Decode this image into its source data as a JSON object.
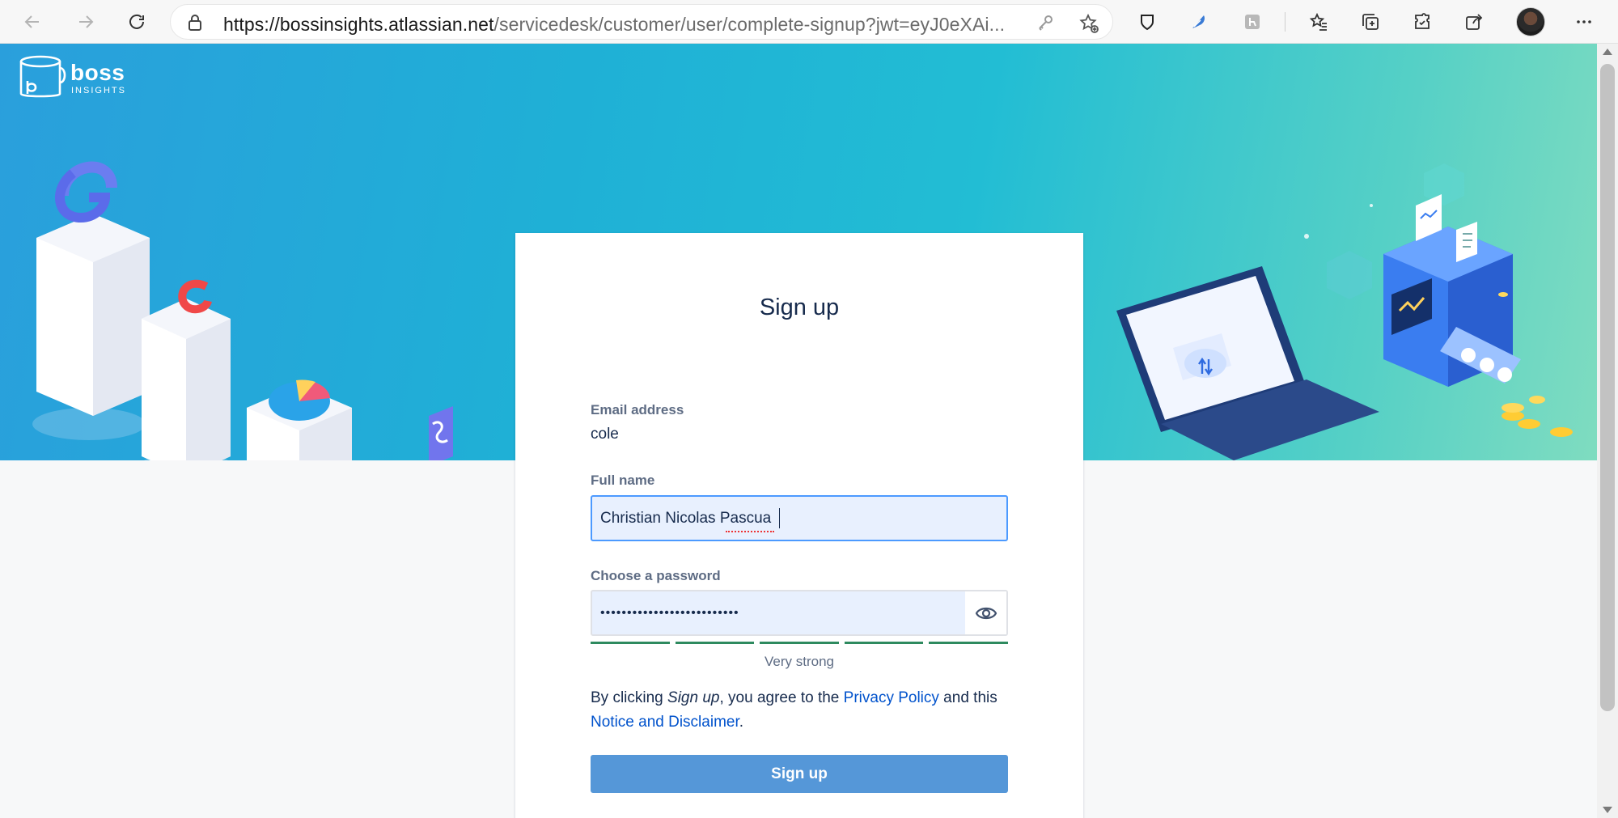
{
  "browser": {
    "url_host": "https://bossinsights.atlassian.net",
    "url_path": "/servicedesk/customer/user/complete-signup?jwt=eyJ0eXAi..."
  },
  "logo": {
    "word": "boss",
    "sub": "INSIGHTS"
  },
  "form": {
    "title": "Sign up",
    "email_label": "Email address",
    "email_value": "cole",
    "fullname_label": "Full name",
    "fullname_value": "Christian Nicolas Pascua",
    "password_label": "Choose a password",
    "password_masked": "••••••••••••••••••••••••••",
    "strength_text": "Very strong",
    "strength_level": 5,
    "terms_prefix": "By clicking ",
    "terms_em": "Sign up",
    "terms_mid": ", you agree to the ",
    "privacy_link": "Privacy Policy",
    "terms_and": " and this ",
    "notice_link": "Notice and Disclaimer",
    "terms_end": ".",
    "signup_button": "Sign up"
  },
  "colors": {
    "accent": "#0052cc",
    "button": "#5597d8",
    "strength_bar": "#2e8a5f",
    "focus_ring": "#4c9aff"
  }
}
